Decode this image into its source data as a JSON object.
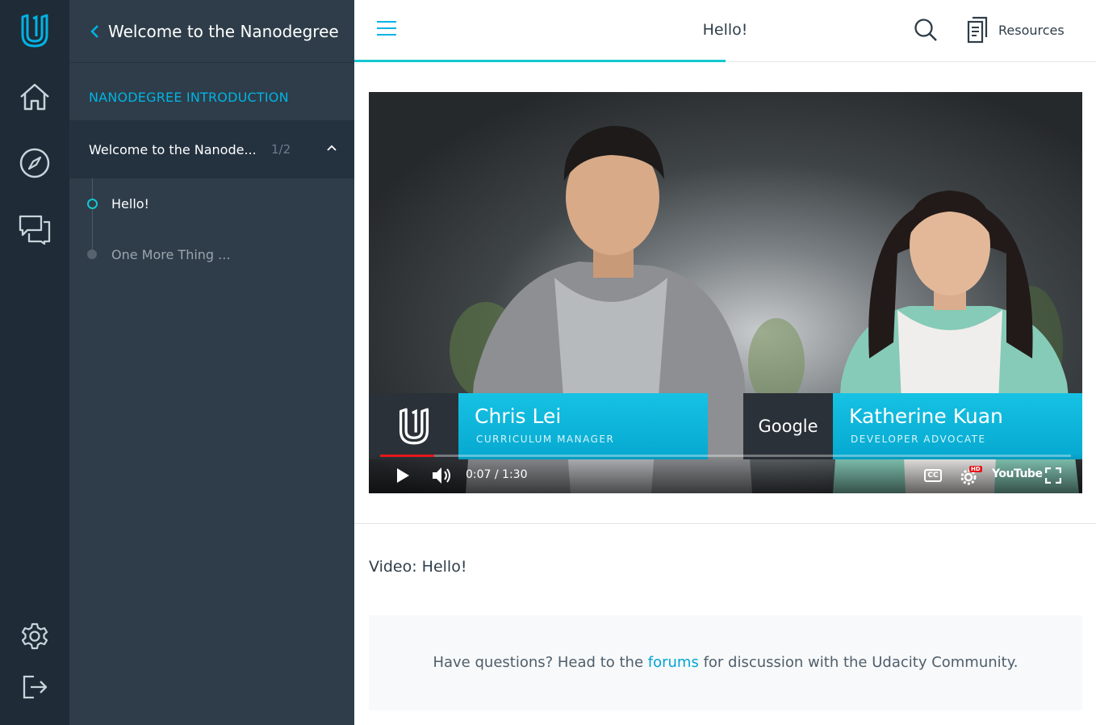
{
  "sidebar": {
    "back_label": "Welcome to the Nanodegree",
    "section_label": "NANODEGREE INTRODUCTION",
    "lesson": {
      "title": "Welcome to the Nanode...",
      "count": "1/2"
    },
    "concepts": [
      {
        "label": "Hello!",
        "active": true
      },
      {
        "label": "One More Thing ...",
        "active": false
      }
    ]
  },
  "header": {
    "title": "Hello!",
    "resources_label": "Resources",
    "progress": 0.5
  },
  "video": {
    "presenter_left": {
      "name": "Chris Lei",
      "role": "CURRICULUM MANAGER"
    },
    "presenter_right": {
      "name": "Katherine Kuan",
      "role": "DEVELOPER ADVOCATE"
    },
    "partner_logo_text": "Google",
    "time": "0:07 / 1:30",
    "played_fraction": 0.078,
    "cc_label": "CC",
    "hd_label": "HD",
    "youtube_label": "YouTube"
  },
  "content": {
    "video_title": "Video: Hello!",
    "forum_prefix": "Have questions? Head to the",
    "forum_link": "forums",
    "forum_suffix": "for discussion with the Udacity Community."
  },
  "colors": {
    "accent": "#02b3e4",
    "rail_bg": "#1f2b36",
    "panel_bg": "#2e3d49",
    "progress_teal": "#15c8d0"
  }
}
